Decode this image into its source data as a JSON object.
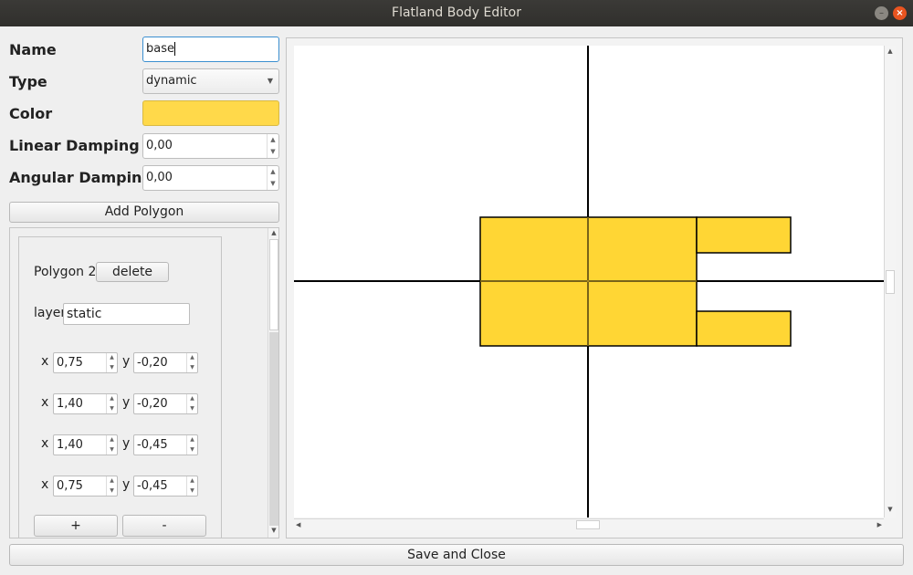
{
  "window": {
    "title": "Flatland Body Editor"
  },
  "form": {
    "name_label": "Name",
    "name_value": "base",
    "type_label": "Type",
    "type_value": "dynamic",
    "color_label": "Color",
    "color_value": "#ffd94a",
    "linear_damping_label": "Linear Damping",
    "linear_damping_value": "0,00",
    "angular_damping_label": "Angular Damping",
    "angular_damping_value": "0,00",
    "add_polygon_label": "Add Polygon"
  },
  "polygon": {
    "title": "Polygon 2",
    "delete_label": "delete",
    "layers_label": "layers:",
    "layers_value": "static",
    "x_label": "x",
    "y_label": "y",
    "vertices": [
      {
        "x": "0,75",
        "y": "-0,20"
      },
      {
        "x": "1,40",
        "y": "-0,20"
      },
      {
        "x": "1,40",
        "y": "-0,45"
      },
      {
        "x": "0,75",
        "y": "-0,45"
      }
    ],
    "add_label": "+",
    "remove_label": "-"
  },
  "footer": {
    "save_close_label": "Save and Close"
  },
  "colors": {
    "body_fill": "#ffd634",
    "accent_focus": "#3b8fd0",
    "close_button": "#e95420"
  }
}
